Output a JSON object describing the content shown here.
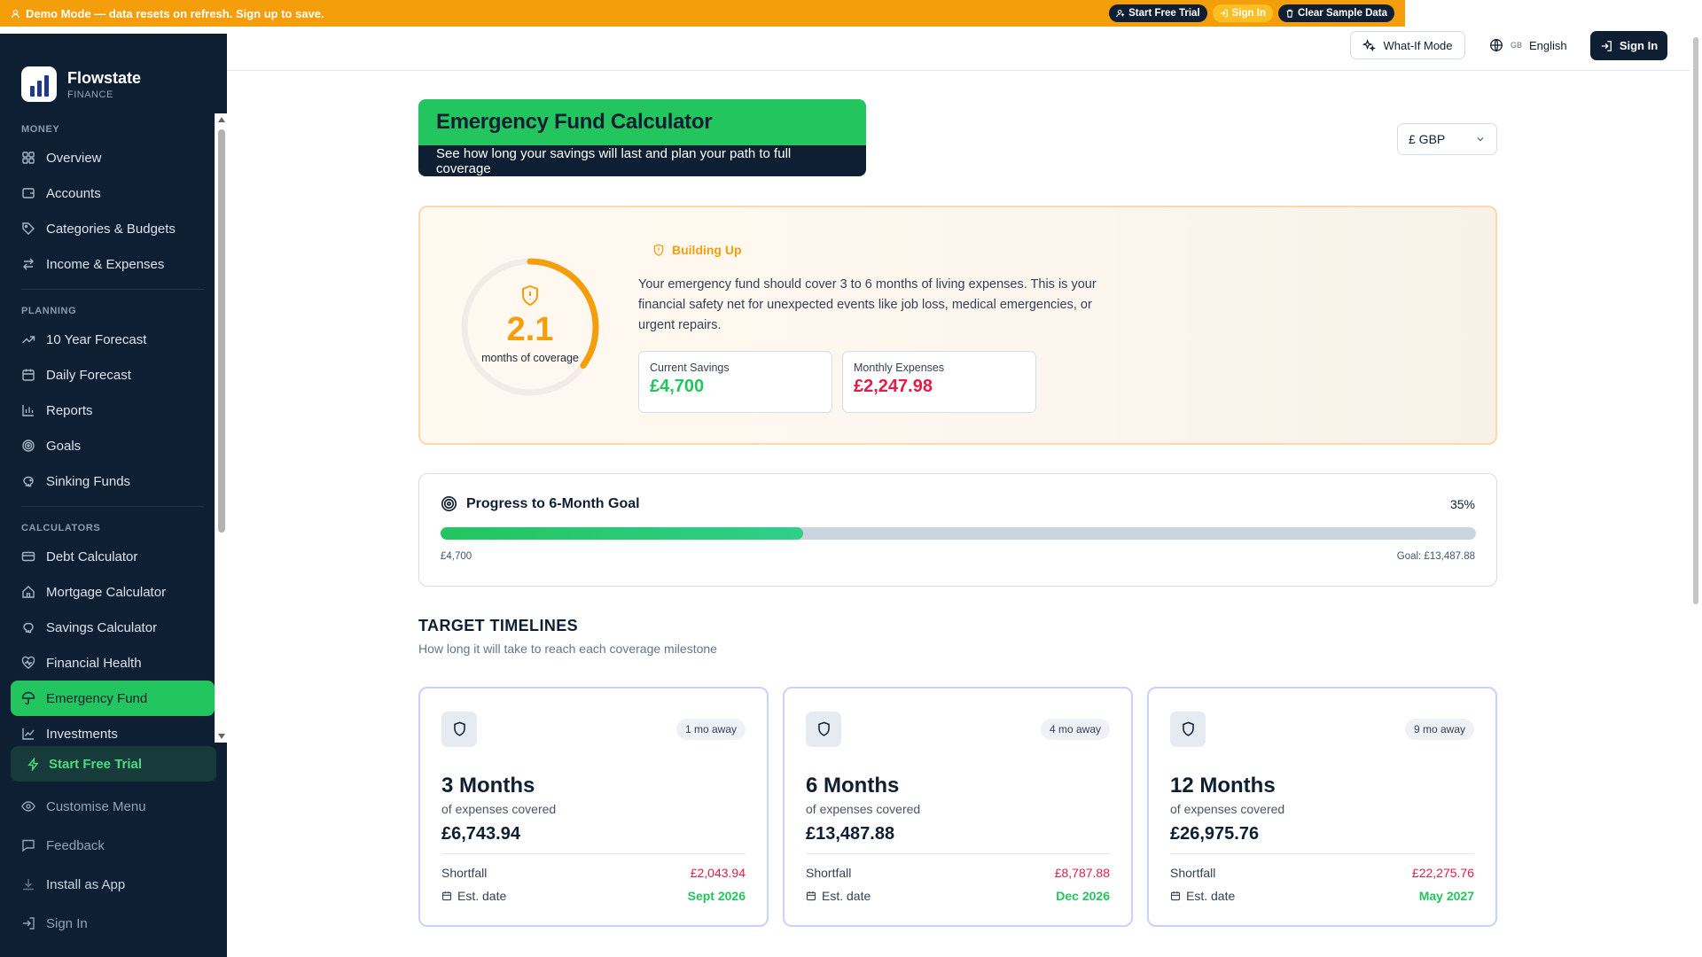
{
  "demo_banner": {
    "text": "Demo Mode — data resets on refresh. Sign up to save.",
    "start_trial": "Start Free Trial",
    "sign_in": "Sign In",
    "clear_data": "Clear Sample Data"
  },
  "brand": {
    "name": "Flowstate",
    "sub": "FINANCE"
  },
  "sidebar": {
    "sections": [
      {
        "heading": "MONEY",
        "items": [
          {
            "label": "Overview",
            "icon": "grid-icon"
          },
          {
            "label": "Accounts",
            "icon": "wallet-icon"
          },
          {
            "label": "Categories & Budgets",
            "icon": "tag-icon"
          },
          {
            "label": "Income & Expenses",
            "icon": "swap-icon"
          }
        ]
      },
      {
        "heading": "PLANNING",
        "items": [
          {
            "label": "10 Year Forecast",
            "icon": "trend-icon"
          },
          {
            "label": "Daily Forecast",
            "icon": "calendar-icon"
          },
          {
            "label": "Reports",
            "icon": "bar-chart-icon"
          },
          {
            "label": "Goals",
            "icon": "target-icon"
          },
          {
            "label": "Sinking Funds",
            "icon": "piggy-icon"
          }
        ]
      },
      {
        "heading": "CALCULATORS",
        "items": [
          {
            "label": "Debt Calculator",
            "icon": "card-icon"
          },
          {
            "label": "Mortgage Calculator",
            "icon": "home-icon"
          },
          {
            "label": "Savings Calculator",
            "icon": "piggy-icon"
          },
          {
            "label": "Financial Health",
            "icon": "heart-icon"
          },
          {
            "label": "Emergency Fund",
            "icon": "umbrella-icon",
            "active": true
          },
          {
            "label": "Investments",
            "icon": "line-chart-icon"
          }
        ]
      }
    ],
    "bottom": {
      "start_trial": "Start Free Trial",
      "customise": "Customise Menu",
      "feedback": "Feedback",
      "install": "Install as App",
      "sign_in": "Sign In"
    }
  },
  "header": {
    "what_if": "What-If Mode",
    "language_flag": "GB",
    "language": "English",
    "sign_in": "Sign In"
  },
  "page": {
    "title": "Emergency Fund Calculator",
    "subtitle": "See how long your savings will last and plan your path to full coverage",
    "currency": "£ GBP"
  },
  "status": {
    "coverage_value": "2.1",
    "coverage_caption": "months of coverage",
    "coverage_months": 2.1,
    "gauge_max_months": 6,
    "label": "Building Up",
    "description": "Your emergency fund should cover 3 to 6 months of living expenses. This is your financial safety net for unexpected events like job loss, medical emergencies, or urgent repairs.",
    "current_savings_label": "Current Savings",
    "current_savings": "£4,700",
    "monthly_expenses_label": "Monthly Expenses",
    "monthly_expenses": "£2,247.98",
    "accent_color": "#f59e0b"
  },
  "progress": {
    "title": "Progress to 6-Month Goal",
    "percent_label": "35%",
    "fraction": 0.35,
    "start_label": "£4,700",
    "goal_label": "Goal: £13,487.88"
  },
  "timelines": {
    "title": "TARGET TIMELINES",
    "subtitle": "How long it will take to reach each coverage milestone",
    "cards": [
      {
        "away": "1 mo away",
        "months": "3 Months",
        "covered": "of expenses covered",
        "amount": "£6,743.94",
        "shortfall_label": "Shortfall",
        "shortfall": "£2,043.94",
        "date_label": "Est. date",
        "date": "Sept 2026"
      },
      {
        "away": "4 mo away",
        "months": "6 Months",
        "covered": "of expenses covered",
        "amount": "£13,487.88",
        "shortfall_label": "Shortfall",
        "shortfall": "£8,787.88",
        "date_label": "Est. date",
        "date": "Dec 2026"
      },
      {
        "away": "9 mo away",
        "months": "12 Months",
        "covered": "of expenses covered",
        "amount": "£26,975.76",
        "shortfall_label": "Shortfall",
        "shortfall": "£22,275.76",
        "date_label": "Est. date",
        "date": "May 2027"
      }
    ]
  },
  "colors": {
    "brand_green": "#22c55e",
    "navy": "#0f1f33",
    "amber": "#f59e0b",
    "danger": "#e11d48"
  }
}
